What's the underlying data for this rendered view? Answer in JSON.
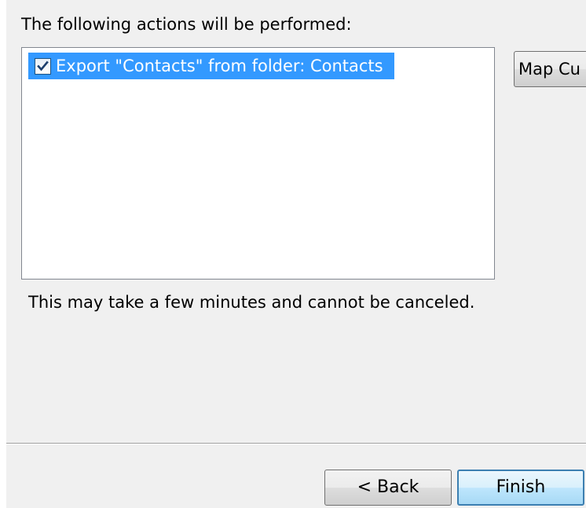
{
  "intro_label": "The following actions will be performed:",
  "actions": [
    {
      "label": "Export \"Contacts\" from folder: Contacts",
      "checked": true
    }
  ],
  "map_button_label": "Map Cu",
  "note_label": "This may take a few minutes and cannot be canceled.",
  "buttons": {
    "back": "< Back",
    "finish": "Finish"
  },
  "colors": {
    "selection": "#3399ff",
    "dialog_bg": "#f0f0f0",
    "default_button_border": "#3c7fb1"
  }
}
